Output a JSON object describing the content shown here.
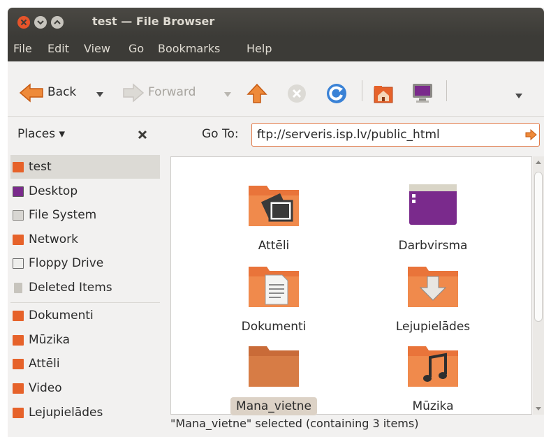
{
  "window": {
    "title": "test — File Browser",
    "accent_color": "#e07a4a"
  },
  "menubar": {
    "items": [
      "File",
      "Edit",
      "View",
      "Go",
      "Bookmarks",
      "Help"
    ]
  },
  "toolbar": {
    "back_label": "Back",
    "forward_label": "Forward",
    "overflow_icon": "chevron-down-icon"
  },
  "location": {
    "places_label": "Places ▾",
    "goto_label": "Go To:",
    "path": "ftp://serveris.isp.lv/public_html"
  },
  "sidebar": {
    "items": [
      {
        "label": "test",
        "icon": "home-folder-icon",
        "selected": true
      },
      {
        "label": "Desktop",
        "icon": "desktop-icon"
      },
      {
        "label": "File System",
        "icon": "filesystem-icon"
      },
      {
        "label": "Network",
        "icon": "network-icon"
      },
      {
        "label": "Floppy Drive",
        "icon": "floppy-icon"
      },
      {
        "label": "Deleted Items",
        "icon": "trash-icon"
      },
      {
        "label": "Dokumenti",
        "icon": "documents-folder-icon"
      },
      {
        "label": "Mūzika",
        "icon": "music-folder-icon"
      },
      {
        "label": "Attēli",
        "icon": "pictures-folder-icon"
      },
      {
        "label": "Video",
        "icon": "video-folder-icon"
      },
      {
        "label": "Lejupielādes",
        "icon": "downloads-folder-icon"
      }
    ]
  },
  "files": [
    {
      "name": "Attēli",
      "icon": "pictures-folder-icon"
    },
    {
      "name": "Darbvirsma",
      "icon": "desktop-folder-icon"
    },
    {
      "name": "Dokumenti",
      "icon": "documents-folder-icon"
    },
    {
      "name": "Lejupielādes",
      "icon": "downloads-folder-icon"
    },
    {
      "name": "Mana_vietne",
      "icon": "folder-icon",
      "selected": true
    },
    {
      "name": "Mūzika",
      "icon": "music-folder-icon"
    }
  ],
  "status": "\"Mana_vietne\" selected (containing 3 items)"
}
